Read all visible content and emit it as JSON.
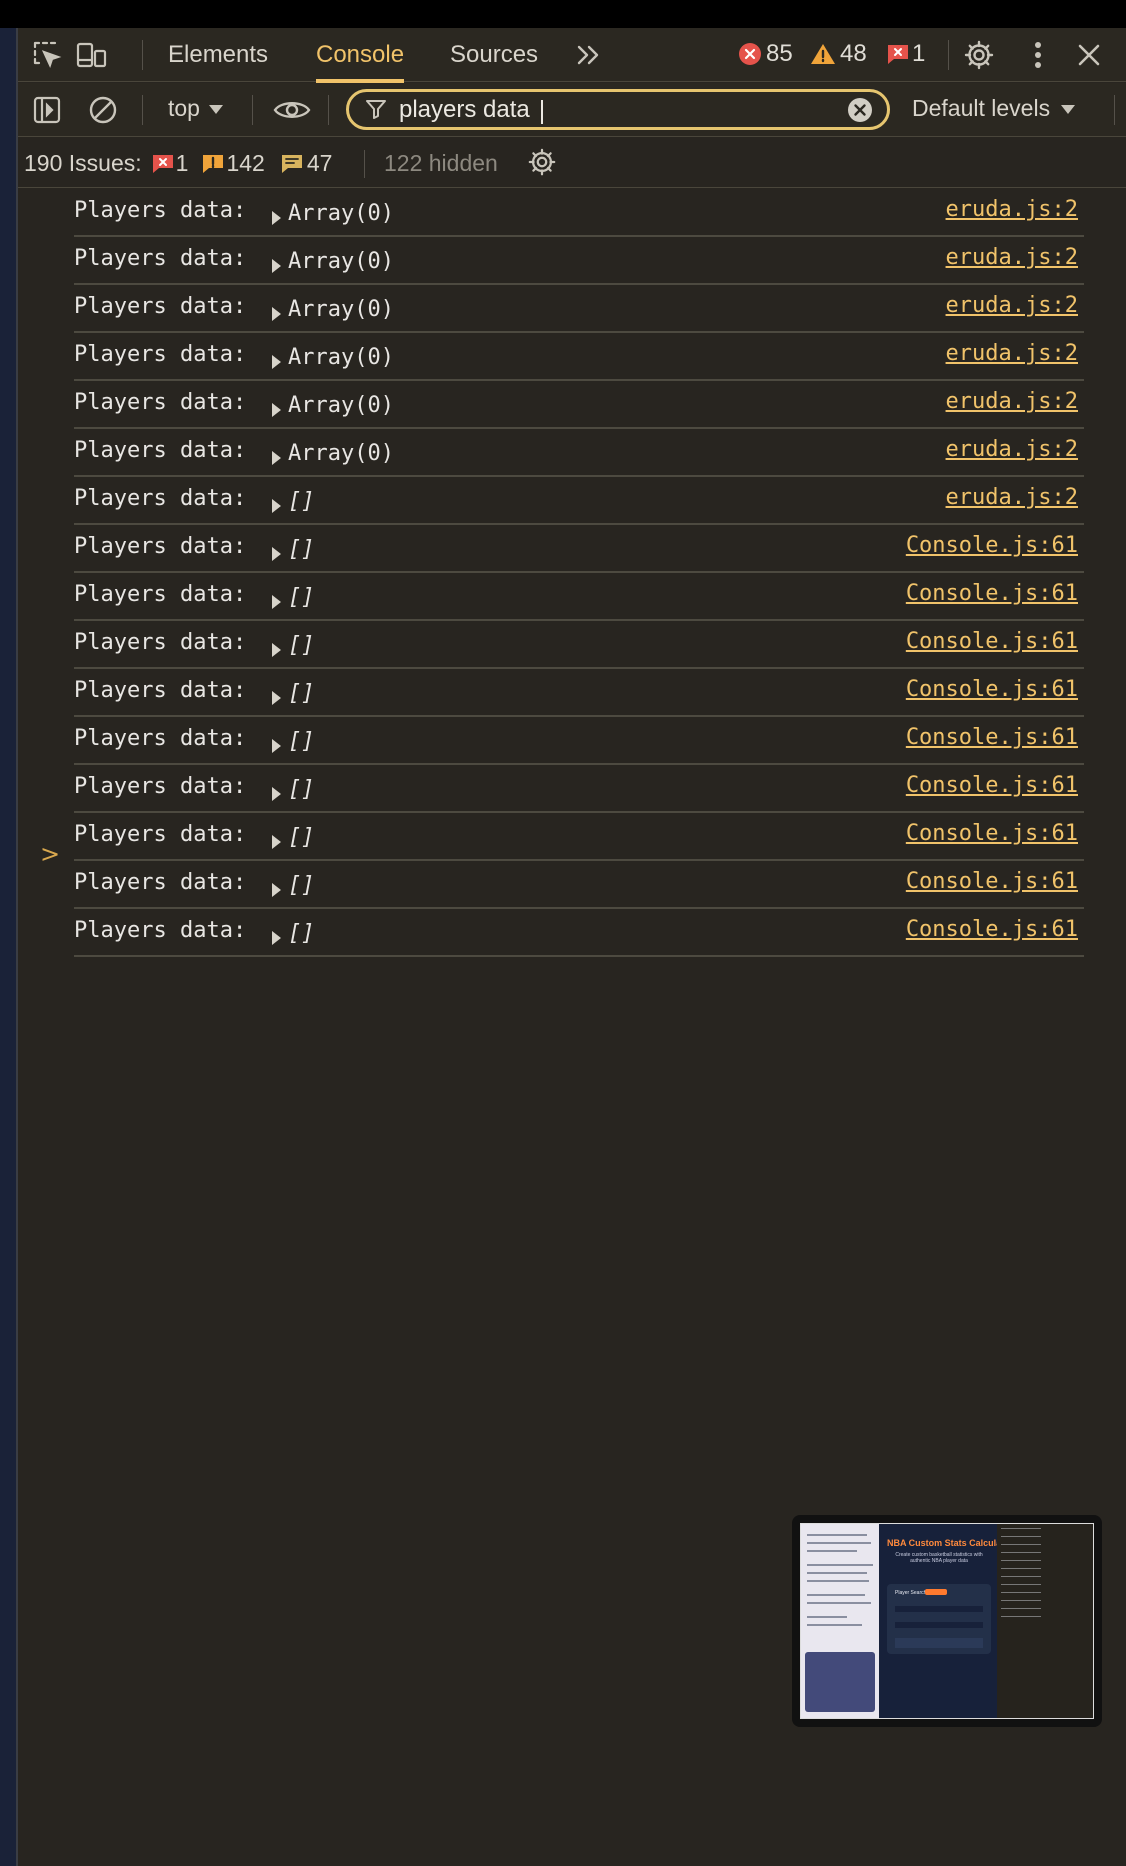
{
  "toolbar": {
    "tabs": [
      "Elements",
      "Console",
      "Sources"
    ],
    "more_tabs_icon": "double-chevron-right-icon",
    "errors_count": "85",
    "warnings_count": "48",
    "issues_count": "1"
  },
  "console_toolbar": {
    "context": "top",
    "filter_value": "players data",
    "levels": "Default levels"
  },
  "issues_bar": {
    "label": "190 Issues:",
    "error_issues": "1",
    "warning_issues": "142",
    "info_issues": "47",
    "hidden": "122 hidden"
  },
  "rows": [
    {
      "message": "Players data:",
      "value": "Array(0)",
      "source": "eruda.js:2"
    },
    {
      "message": "Players data:",
      "value": "Array(0)",
      "source": "eruda.js:2"
    },
    {
      "message": "Players data:",
      "value": "Array(0)",
      "source": "eruda.js:2"
    },
    {
      "message": "Players data:",
      "value": "Array(0)",
      "source": "eruda.js:2"
    },
    {
      "message": "Players data:",
      "value": "Array(0)",
      "source": "eruda.js:2"
    },
    {
      "message": "Players data:",
      "value": "Array(0)",
      "source": "eruda.js:2"
    },
    {
      "message": "Players data:",
      "value": "[]",
      "source": "eruda.js:2"
    },
    {
      "message": "Players data:",
      "value": "[]",
      "source": "Console.js:61"
    },
    {
      "message": "Players data:",
      "value": "[]",
      "source": "Console.js:61"
    },
    {
      "message": "Players data:",
      "value": "[]",
      "source": "Console.js:61"
    },
    {
      "message": "Players data:",
      "value": "[]",
      "source": "Console.js:61"
    },
    {
      "message": "Players data:",
      "value": "[]",
      "source": "Console.js:61"
    },
    {
      "message": "Players data:",
      "value": "[]",
      "source": "Console.js:61"
    },
    {
      "message": "Players data:",
      "value": "[]",
      "source": "Console.js:61"
    },
    {
      "message": "Players data:",
      "value": "[]",
      "source": "Console.js:61"
    },
    {
      "message": "Players data:",
      "value": "[]",
      "source": "Console.js:61"
    }
  ],
  "prompt_symbol": ">",
  "thumbnail": {
    "title": "NBA Custom Stats Calculator",
    "subtitle": "Create custom basketball statistics with authentic NBA player data",
    "card_title": "Player Search"
  },
  "colors": {
    "accent": "#f1c36a",
    "error": "#e5534b",
    "warning": "#f0a43a"
  }
}
